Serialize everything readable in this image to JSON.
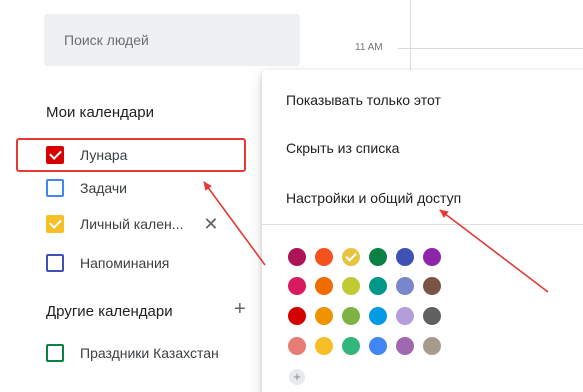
{
  "search": {
    "placeholder": "Поиск людей"
  },
  "time_label": "11 AM",
  "my_calendars": {
    "title": "Мои календари",
    "items": [
      {
        "label": "Лунара",
        "color": "#d50000",
        "checked": true
      },
      {
        "label": "Задачи",
        "color": "#4285f4",
        "checked": false
      },
      {
        "label": "Личный кален...",
        "color": "#f6bf26",
        "checked": true,
        "close": "✕"
      },
      {
        "label": "Напоминания",
        "color": "#3f51b5",
        "checked": false
      }
    ]
  },
  "other_calendars": {
    "title": "Другие календари",
    "add_icon": "+",
    "items": [
      {
        "label": "Праздники Казахстан",
        "color": "#0b8043",
        "checked": false
      }
    ]
  },
  "menu": {
    "items": [
      "Показывать только этот",
      "Скрыть из списка",
      "Настройки и общий доступ"
    ],
    "add_color": "+",
    "color_rows": [
      [
        "#ad1457",
        "#f4511e",
        "#e4c441",
        "#0b8043",
        "#3f51b5",
        "#8e24aa"
      ],
      [
        "#d81b60",
        "#ef6c00",
        "#c0ca33",
        "#009688",
        "#7986cb",
        "#795548"
      ],
      [
        "#d50000",
        "#f09300",
        "#7cb342",
        "#039be5",
        "#b39ddb",
        "#616161"
      ],
      [
        "#e67c73",
        "#f6bf26",
        "#33b679",
        "#4285f4",
        "#9e69af",
        "#a79b8e"
      ]
    ],
    "selected_color": "#e4c441"
  },
  "annotation_color": "#e53935"
}
